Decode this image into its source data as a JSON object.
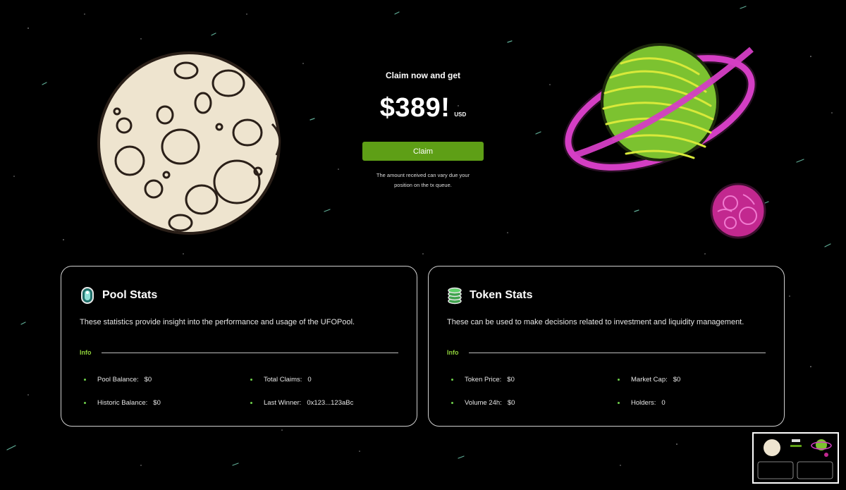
{
  "hero": {
    "kicker": "Claim now and get",
    "amount": "$389!",
    "currency": "USD",
    "claim_label": "Claim",
    "note_line1": "The amount received can vary due your",
    "note_line2": "position on the tx queue."
  },
  "pool_stats": {
    "title": "Pool Stats",
    "description": "These statistics provide insight into the performance and usage of the UFOPool.",
    "info_label": "Info",
    "items": [
      {
        "label": "Pool Balance:",
        "value": "$0"
      },
      {
        "label": "Total Claims:",
        "value": "0"
      },
      {
        "label": "Historic Balance:",
        "value": "$0"
      },
      {
        "label": "Last Winner:",
        "value": "0x123...123aBc"
      }
    ]
  },
  "token_stats": {
    "title": "Token Stats",
    "description": "These can be used to make decisions related to investment and liquidity management.",
    "info_label": "Info",
    "items": [
      {
        "label": "Token Price:",
        "value": "$0"
      },
      {
        "label": "Market Cap:",
        "value": "$0"
      },
      {
        "label": "Volume 24h:",
        "value": "$0"
      },
      {
        "label": "Holders:",
        "value": "0"
      }
    ]
  },
  "colors": {
    "background": "#000000",
    "claim_button": "#5e9f16",
    "info_accent": "#8fd13a",
    "bullet": "#6ed04a",
    "saturn_ring": "#d43ec4",
    "saturn_body": "#8fd13a",
    "moon": "#eee4cf"
  },
  "icons": {
    "pool": "capsule-pool-icon",
    "token": "coin-stack-icon"
  }
}
